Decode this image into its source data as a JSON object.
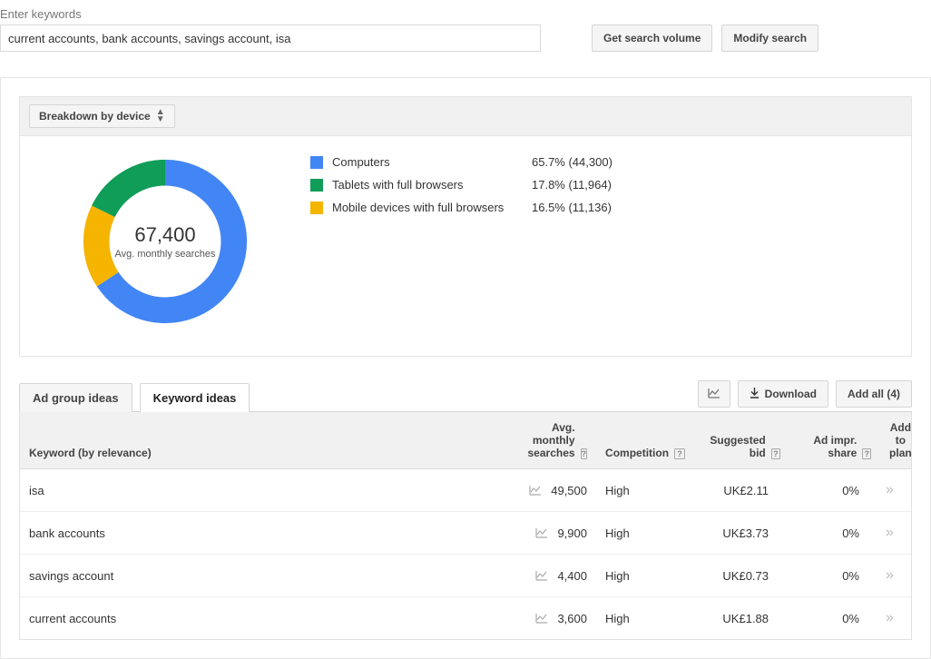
{
  "header": {
    "label": "Enter keywords",
    "input_value": "current accounts, bank accounts, savings account, isa",
    "get_volume_btn": "Get search volume",
    "modify_btn": "Modify search"
  },
  "breakdown": {
    "selector_label": "Breakdown by device",
    "center_value": "67,400",
    "center_label": "Avg. monthly searches",
    "items": [
      {
        "label": "Computers",
        "value": "65.7% (44,300)",
        "color": "#4285f4"
      },
      {
        "label": "Tablets with full browsers",
        "value": "17.8% (11,964)",
        "color": "#0f9d58"
      },
      {
        "label": "Mobile devices with full browsers",
        "value": "16.5% (11,136)",
        "color": "#f4b400"
      }
    ]
  },
  "chart_data": {
    "type": "pie",
    "title": "Breakdown by device",
    "center_value": 67400,
    "center_label": "Avg. monthly searches",
    "series": [
      {
        "name": "Computers",
        "percent": 65.7,
        "count": 44300,
        "color": "#4285f4"
      },
      {
        "name": "Tablets with full browsers",
        "percent": 17.8,
        "count": 11964,
        "color": "#0f9d58"
      },
      {
        "name": "Mobile devices with full browsers",
        "percent": 16.5,
        "count": 11136,
        "color": "#f4b400"
      }
    ]
  },
  "tabs": {
    "adgroup": "Ad group ideas",
    "keyword": "Keyword ideas",
    "download": "Download",
    "addall": "Add all (4)"
  },
  "table": {
    "headers": {
      "keyword": "Keyword (by relevance)",
      "ams": "Avg. monthly searches",
      "competition": "Competition",
      "bid": "Suggested bid",
      "impr": "Ad impr. share",
      "add": "Add to plan"
    },
    "rows": [
      {
        "keyword": "isa",
        "ams": "49,500",
        "competition": "High",
        "bid": "UK£2.11",
        "impr": "0%"
      },
      {
        "keyword": "bank accounts",
        "ams": "9,900",
        "competition": "High",
        "bid": "UK£3.73",
        "impr": "0%"
      },
      {
        "keyword": "savings account",
        "ams": "4,400",
        "competition": "High",
        "bid": "UK£0.73",
        "impr": "0%"
      },
      {
        "keyword": "current accounts",
        "ams": "3,600",
        "competition": "High",
        "bid": "UK£1.88",
        "impr": "0%"
      }
    ]
  }
}
